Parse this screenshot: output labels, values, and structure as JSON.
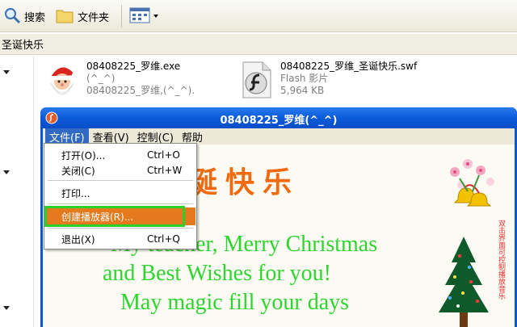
{
  "toolbar": {
    "search_label": "搜索",
    "folders_label": "文件夹"
  },
  "address": {
    "path": "圣诞快乐"
  },
  "files": [
    {
      "name": "08408225_罗维.exe",
      "line2": "(^_^)",
      "line3": "08408225_罗维,(^_^)."
    },
    {
      "name": "08408225_罗维_圣诞快乐.swf",
      "line2": "Flash 影片",
      "line3": "5,964 KB"
    }
  ],
  "player": {
    "title": "08408225_罗维(^_^)",
    "menus": [
      "文件(F)",
      "查看(V)",
      "控制(C)",
      "帮助"
    ],
    "greeting_title": "诞快乐",
    "lines": [
      "My teacher, Merry Christmas",
      "and Best  Wishes for you!",
      "May magic fill your days"
    ],
    "side_note": "双击界面可控制播放音乐"
  },
  "file_menu": {
    "items": [
      {
        "label": "打开(O)...",
        "shortcut": "Ctrl+O"
      },
      {
        "label": "关闭(C)",
        "shortcut": "Ctrl+W"
      },
      {
        "label": "打印...",
        "shortcut": ""
      },
      {
        "label": "创建播放器(R)...",
        "shortcut": ""
      },
      {
        "label": "退出(X)",
        "shortcut": "Ctrl+Q"
      }
    ]
  },
  "colors": {
    "menu_highlight": "#e4791d",
    "annotation": "#2bd12b",
    "title_bar": "#0a57d8",
    "greeting": "#f06a10",
    "text_green": "#2fd42f"
  }
}
